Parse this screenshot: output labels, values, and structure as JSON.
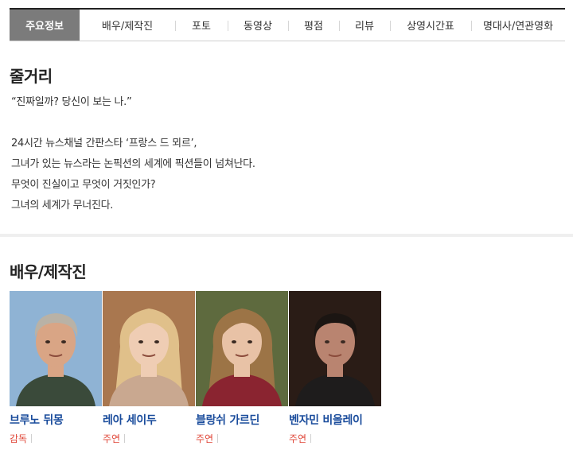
{
  "tabs": [
    {
      "label": "주요정보",
      "active": true,
      "width": 88
    },
    {
      "label": "배우/제작진",
      "width": 120
    },
    {
      "label": "포토",
      "width": 66
    },
    {
      "label": "동영상",
      "width": 76
    },
    {
      "label": "평점",
      "width": 64
    },
    {
      "label": "리뷰",
      "width": 64
    },
    {
      "label": "상영시간표",
      "width": 102
    },
    {
      "label": "명대사/연관영화",
      "width": 118
    }
  ],
  "synopsis": {
    "title": "줄거리",
    "lines": [
      "“진짜일까? 당신이 보는 나.”",
      "",
      "24시간 뉴스채널 간판스타 ‘프랑스 드 뫼르’,",
      "그녀가 있는 뉴스라는 논픽션의 세계에 픽션들이 넘쳐난다.",
      "무엇이 진실이고 무엇이 거짓인가?",
      "그녀의 세계가 무너진다."
    ]
  },
  "cast_section": {
    "title": "배우/제작진",
    "people": [
      {
        "name": "브루노 뒤몽",
        "role": "감독",
        "bg": "#8fb3d4",
        "hair": "#b9b2a6",
        "skin": "#d9a585",
        "shirt": "#3a4a3a"
      },
      {
        "name": "레아 세이두",
        "role": "주연",
        "bg": "#a9774f",
        "hair": "#e0c08a",
        "skin": "#efcdb4",
        "shirt": "#c9a890"
      },
      {
        "name": "블랑쉬 가르딘",
        "role": "주연",
        "bg": "#5e6a3e",
        "hair": "#9c7446",
        "skin": "#e8c2a6",
        "shirt": "#8a2430"
      },
      {
        "name": "벤자민 비올레이",
        "role": "주연",
        "bg": "#2a1c16",
        "hair": "#1b1512",
        "skin": "#b98470",
        "shirt": "#1e1c1c"
      }
    ]
  }
}
